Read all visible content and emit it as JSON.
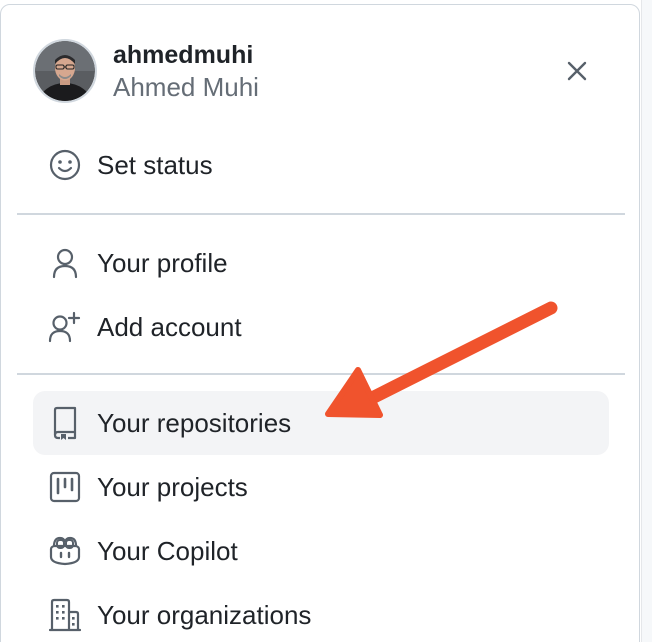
{
  "user": {
    "username": "ahmedmuhi",
    "full_name": "Ahmed Muhi"
  },
  "menu": {
    "set_status": "Set status",
    "your_profile": "Your profile",
    "add_account": "Add account",
    "your_repositories": "Your repositories",
    "your_projects": "Your projects",
    "your_copilot": "Your Copilot",
    "your_organizations": "Your organizations"
  },
  "icons": {
    "close": "x-icon",
    "set_status": "smiley-icon",
    "your_profile": "person-icon",
    "add_account": "person-add-icon",
    "your_repositories": "repo-icon",
    "your_projects": "project-icon",
    "your_copilot": "copilot-icon",
    "your_organizations": "organization-icon"
  },
  "colors": {
    "annotation_arrow": "#f0532d",
    "active_row_bg": "#f3f4f6",
    "text_primary": "#1f2328",
    "text_muted": "#656d76"
  }
}
